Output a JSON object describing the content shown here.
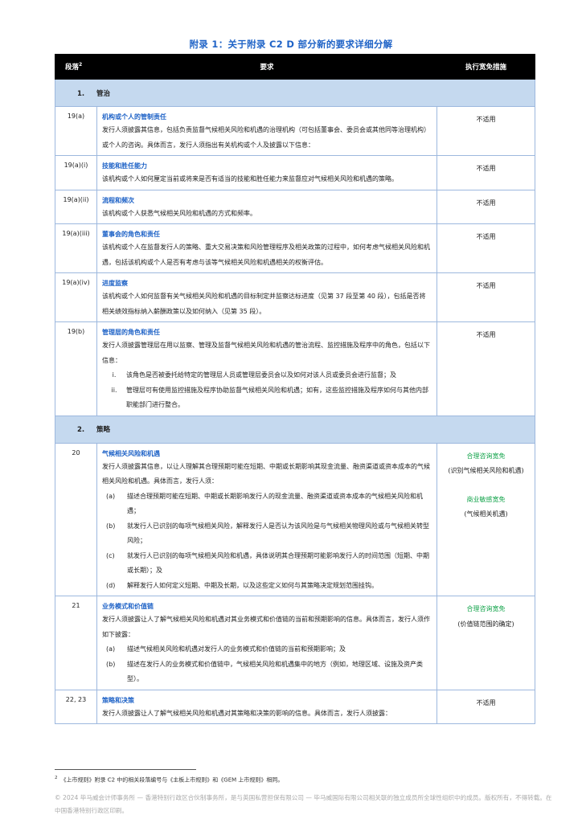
{
  "title": "附录 1：关于附录 C2 D 部分新的要求详细分解",
  "header": {
    "para": "段落",
    "para_sup": "2",
    "req": "要求",
    "exempt": "执行宽免措施"
  },
  "sections": [
    {
      "num": "1.",
      "label": "管治"
    },
    {
      "num": "2.",
      "label": "策略"
    }
  ],
  "rows": [
    {
      "para": "19(a)",
      "title": "机构或个人的管制责任",
      "body": "发行人须披露其信息，包括负责监督气候相关风险和机遇的治理机构（可包括董事会、委员会或其他同等治理机构）或个人的咨询。具体而言，发行人须指出有关机构或个人及披露以下信息：",
      "exempt": "不适用"
    },
    {
      "para": "19(a)(i)",
      "title": "技能和胜任能力",
      "body": "该机构或个人如何厘定当前或将来是否有适当的技能和胜任能力来监督应对气候相关风险和机遇的策略。",
      "exempt": "不适用"
    },
    {
      "para": "19(a)(ii)",
      "title": "流程和频次",
      "body": "该机构或个人获悉气候相关风险和机遇的方式和频率。",
      "exempt": "不适用"
    },
    {
      "para": "19(a)(iii)",
      "title": "董事会的角色和责任",
      "body": "该机构或个人在监督发行人的策略、重大交易决策和风险管理程序及相关政策的过程中，如何考虑气候相关风险和机遇，包括该机构或个人是否有考虑与该等气候相关风险和机遇相关的权衡评估。",
      "exempt": "不适用"
    },
    {
      "para": "19(a)(iv)",
      "title": "进度监察",
      "body": "该机构或个人如何监督有关气候相关风险和机遇的目标制定并监察达标进度（见第 37 段至第 40 段），包括是否将相关绩效指标纳入薪酬政策以及如何纳入（见第 35 段）。",
      "exempt": "不适用"
    },
    {
      "para": "19(b)",
      "title": "管理层的角色和责任",
      "body": "发行人须披露管理层在用以监察、管理及监督气候相关风险和机遇的管治流程、监控措施及程序中的角色，包括以下信息：",
      "items": [
        {
          "label": "i.",
          "text": "该角色是否被委托给特定的管理层人员或管理层委员会以及如何对该人员或委员会进行监督；及"
        },
        {
          "label": "ii.",
          "text": "管理层可有使用监控措施及程序协助监督气候相关风险和机遇；如有，这些监控措施及程序如何与其他内部职能部门进行整合。"
        }
      ],
      "exempt": "不适用"
    },
    {
      "para": "20",
      "title": "气候相关风险和机遇",
      "body": "发行人须披露其信息，以让人理解其合理预期可能在短期、中期或长期影响其现金流量、融资渠道或资本成本的气候相关风险和机遇。具体而言，发行人须：",
      "items": [
        {
          "label": "(a)",
          "text": "描述合理预期可能在短期、中期或长期影响发行人的现金流量、融资渠道或资本成本的气候相关风险和机遇；"
        },
        {
          "label": "(b)",
          "text": "就发行人已识别的每项气候相关风险，解释发行人是否认为该风险是与气候相关物理风险或与气候相关转型风险；"
        },
        {
          "label": "(c)",
          "text": "就发行人已识别的每项气候相关风险和机遇，具体说明其合理预期可能影响发行人的时间范围（短期、中期或长期）；及"
        },
        {
          "label": "(d)",
          "text": "解释发行人如何定义短期、中期及长期，以及这些定义如何与其策略决定规划范围挂钩。"
        }
      ],
      "exempt_items": [
        {
          "title": "合理咨询宽免",
          "desc": "(识别气候相关风险和机遇)"
        },
        {
          "title": "商业敏感宽免",
          "desc": "(气候相关机遇)"
        }
      ]
    },
    {
      "para": "21",
      "title": "业务模式和价值链",
      "body": "发行人须披露让人了解气候相关风险和机遇对其业务模式和价值链的当前和预期影响的信息。具体而言，发行人须作如下披露：",
      "items": [
        {
          "label": "(a)",
          "text": "描述气候相关风险和机遇对发行人的业务模式和价值链的当前和预期影响；及"
        },
        {
          "label": "(b)",
          "text": "描述在发行人的业务模式和价值链中，气候相关风险和机遇集中的地方（例如，地理区域、设施及资产类型）。"
        }
      ],
      "exempt_items": [
        {
          "title": "合理咨询宽免",
          "desc": "(价值链范围的确定)"
        }
      ]
    },
    {
      "para": "22, 23",
      "title": "策略和决策",
      "body": "发行人须披露让人了解气候相关风险和机遇对其策略和决策的影响的信息。具体而言，发行人须披露：",
      "exempt": "不适用"
    }
  ],
  "footnote": {
    "num": "2",
    "text": "《上市规则》附录 C2 中的相关段落编号与《主板上市规则》和《GEM 上市规则》相同。"
  },
  "copyright": "© 2024 毕马威会计师事务所 — 香港特别行政区合伙制事务所，是与英国私营担保有限公司 — 毕马威国际有限公司相关联的独立成员所全球性组织中的成员。版权所有，不得转载。在中国香港特别行政区印刷。",
  "colors": {
    "title_blue": "#1f63c7",
    "header_bg": "#000000",
    "section_bg": "#c5d9ef",
    "exempt_green": "#12a34a",
    "border": "#9db8de"
  }
}
